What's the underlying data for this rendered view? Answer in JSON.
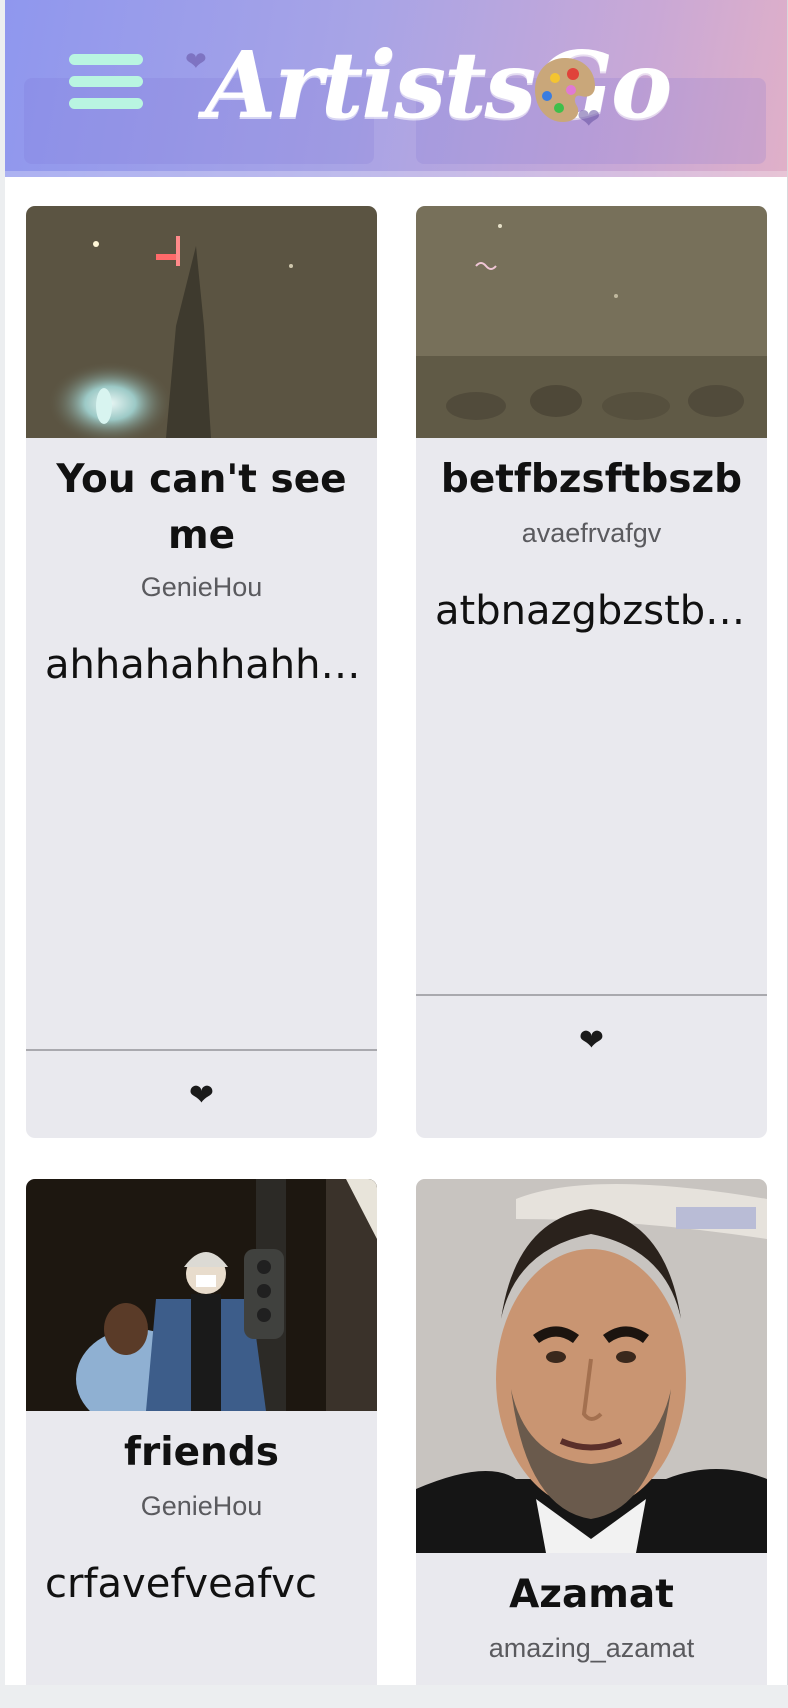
{
  "app": {
    "logo_text": "ArtistsGo",
    "colors": {
      "header_gradient_start": "#8f97ee",
      "header_gradient_end": "#e0b0c8",
      "menu_icon": "#b9f5e1",
      "card_background": "#e9e9ee"
    }
  },
  "header": {
    "menu_icon": "hamburger-menu-icon",
    "logo_icon": "palette-icon"
  },
  "posts": [
    {
      "title": "You can't see me",
      "author": "GenieHou",
      "description": "ahhahahhahhahhahaha",
      "like_icon": "heart-icon",
      "like_symbol": "❤"
    },
    {
      "title": "betfbzsftbszb",
      "author": "avaefrvafgv",
      "description": "atbnazgbzstbzsbt",
      "like_icon": "heart-icon",
      "like_symbol": "❤"
    },
    {
      "title": "friends",
      "author": "GenieHou",
      "description": "crfavefveafvc",
      "like_icon": "heart-icon",
      "like_symbol": "❤"
    },
    {
      "title": "Azamat",
      "author": "amazing_azamat",
      "description": "",
      "like_icon": "heart-icon",
      "like_symbol": "❤"
    }
  ]
}
